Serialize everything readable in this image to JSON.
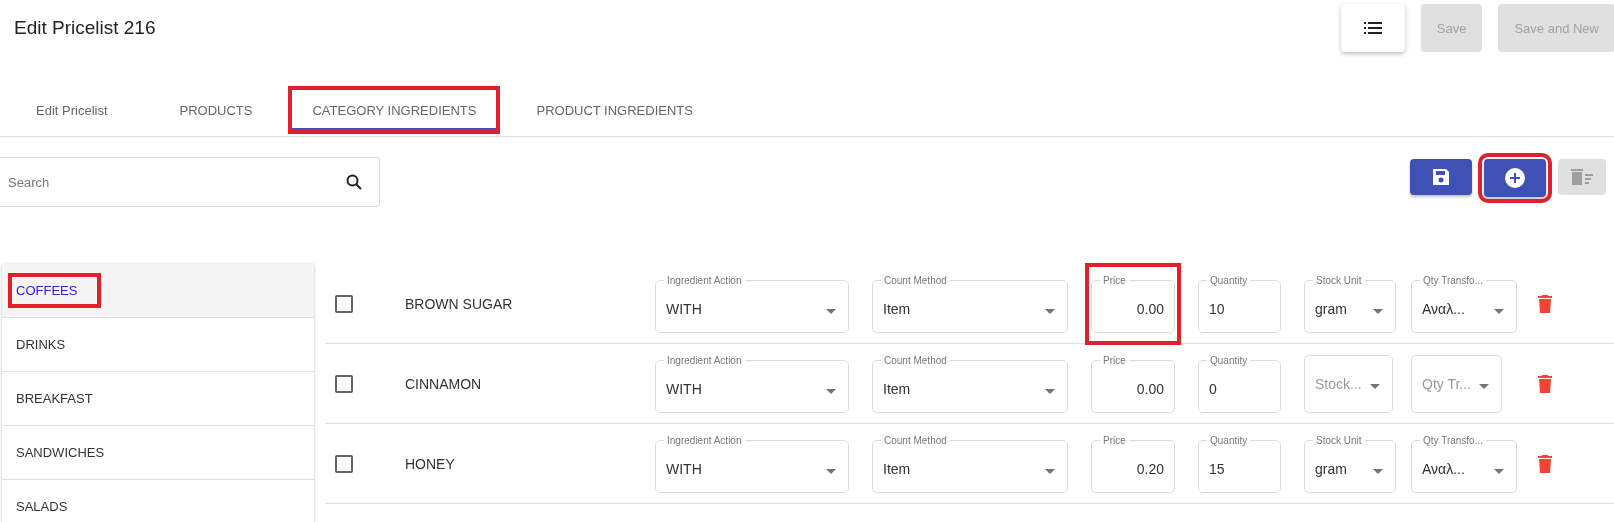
{
  "title": "Edit Pricelist 216",
  "header_buttons": [
    {
      "kind": "list"
    },
    {
      "kind": "text",
      "label": "Save",
      "disabled": true
    },
    {
      "kind": "text",
      "label": "Save and New",
      "disabled": true
    }
  ],
  "tabs": [
    {
      "label": "Edit Pricelist",
      "selected": false,
      "highlighted": false
    },
    {
      "label": "PRODUCTS",
      "selected": false,
      "highlighted": false
    },
    {
      "label": "CATEGORY INGREDIENTS",
      "selected": true,
      "highlighted": true
    },
    {
      "label": "PRODUCT INGREDIENTS",
      "selected": false,
      "highlighted": false
    }
  ],
  "search": {
    "placeholder": "Search"
  },
  "toolbar": [
    {
      "kind": "save",
      "disabled": false,
      "highlighted": false
    },
    {
      "kind": "add",
      "disabled": false,
      "highlighted": true
    },
    {
      "kind": "delete",
      "disabled": true,
      "highlighted": false
    }
  ],
  "categories": [
    {
      "label": "COFFEES",
      "selected": true,
      "highlighted": true
    },
    {
      "label": "DRINKS",
      "selected": false,
      "highlighted": false
    },
    {
      "label": "BREAKFAST",
      "selected": false,
      "highlighted": false
    },
    {
      "label": "SANDWICHES",
      "selected": false,
      "highlighted": false
    },
    {
      "label": "SALADS",
      "selected": false,
      "highlighted": false
    }
  ],
  "rows": [
    {
      "checked": false,
      "name": "BROWN SUGAR",
      "fields": [
        {
          "kind": "select",
          "label": "Ingredient Action",
          "value": "WITH"
        },
        {
          "kind": "select",
          "label": "Count Method",
          "value": "Item"
        },
        {
          "kind": "amount",
          "label": "Price",
          "value": "0.00",
          "highlighted": true
        },
        {
          "kind": "input",
          "label": "Quantity",
          "value": "10"
        },
        {
          "kind": "select",
          "label": "Stock Unit",
          "value": "gram"
        },
        {
          "kind": "select",
          "label": "Qty Transfo...",
          "value": "Αναλ..."
        }
      ]
    },
    {
      "checked": false,
      "name": "CINNAMON",
      "fields": [
        {
          "kind": "select",
          "label": "Ingredient Action",
          "value": "WITH"
        },
        {
          "kind": "select",
          "label": "Count Method",
          "value": "Item"
        },
        {
          "kind": "amount",
          "label": "Price",
          "value": "0.00"
        },
        {
          "kind": "input",
          "label": "Quantity",
          "value": "0"
        },
        {
          "kind": "select",
          "placeholder": "Stock..."
        },
        {
          "kind": "select",
          "placeholder": "Qty Tr..."
        }
      ]
    },
    {
      "checked": false,
      "name": "HONEY",
      "fields": [
        {
          "kind": "select",
          "label": "Ingredient Action",
          "value": "WITH"
        },
        {
          "kind": "select",
          "label": "Count Method",
          "value": "Item"
        },
        {
          "kind": "amount",
          "label": "Price",
          "value": "0.20"
        },
        {
          "kind": "input",
          "label": "Quantity",
          "value": "15"
        },
        {
          "kind": "select",
          "label": "Stock Unit",
          "value": "gram"
        },
        {
          "kind": "select",
          "label": "Qty Transfo...",
          "value": "Αναλ..."
        }
      ]
    }
  ]
}
